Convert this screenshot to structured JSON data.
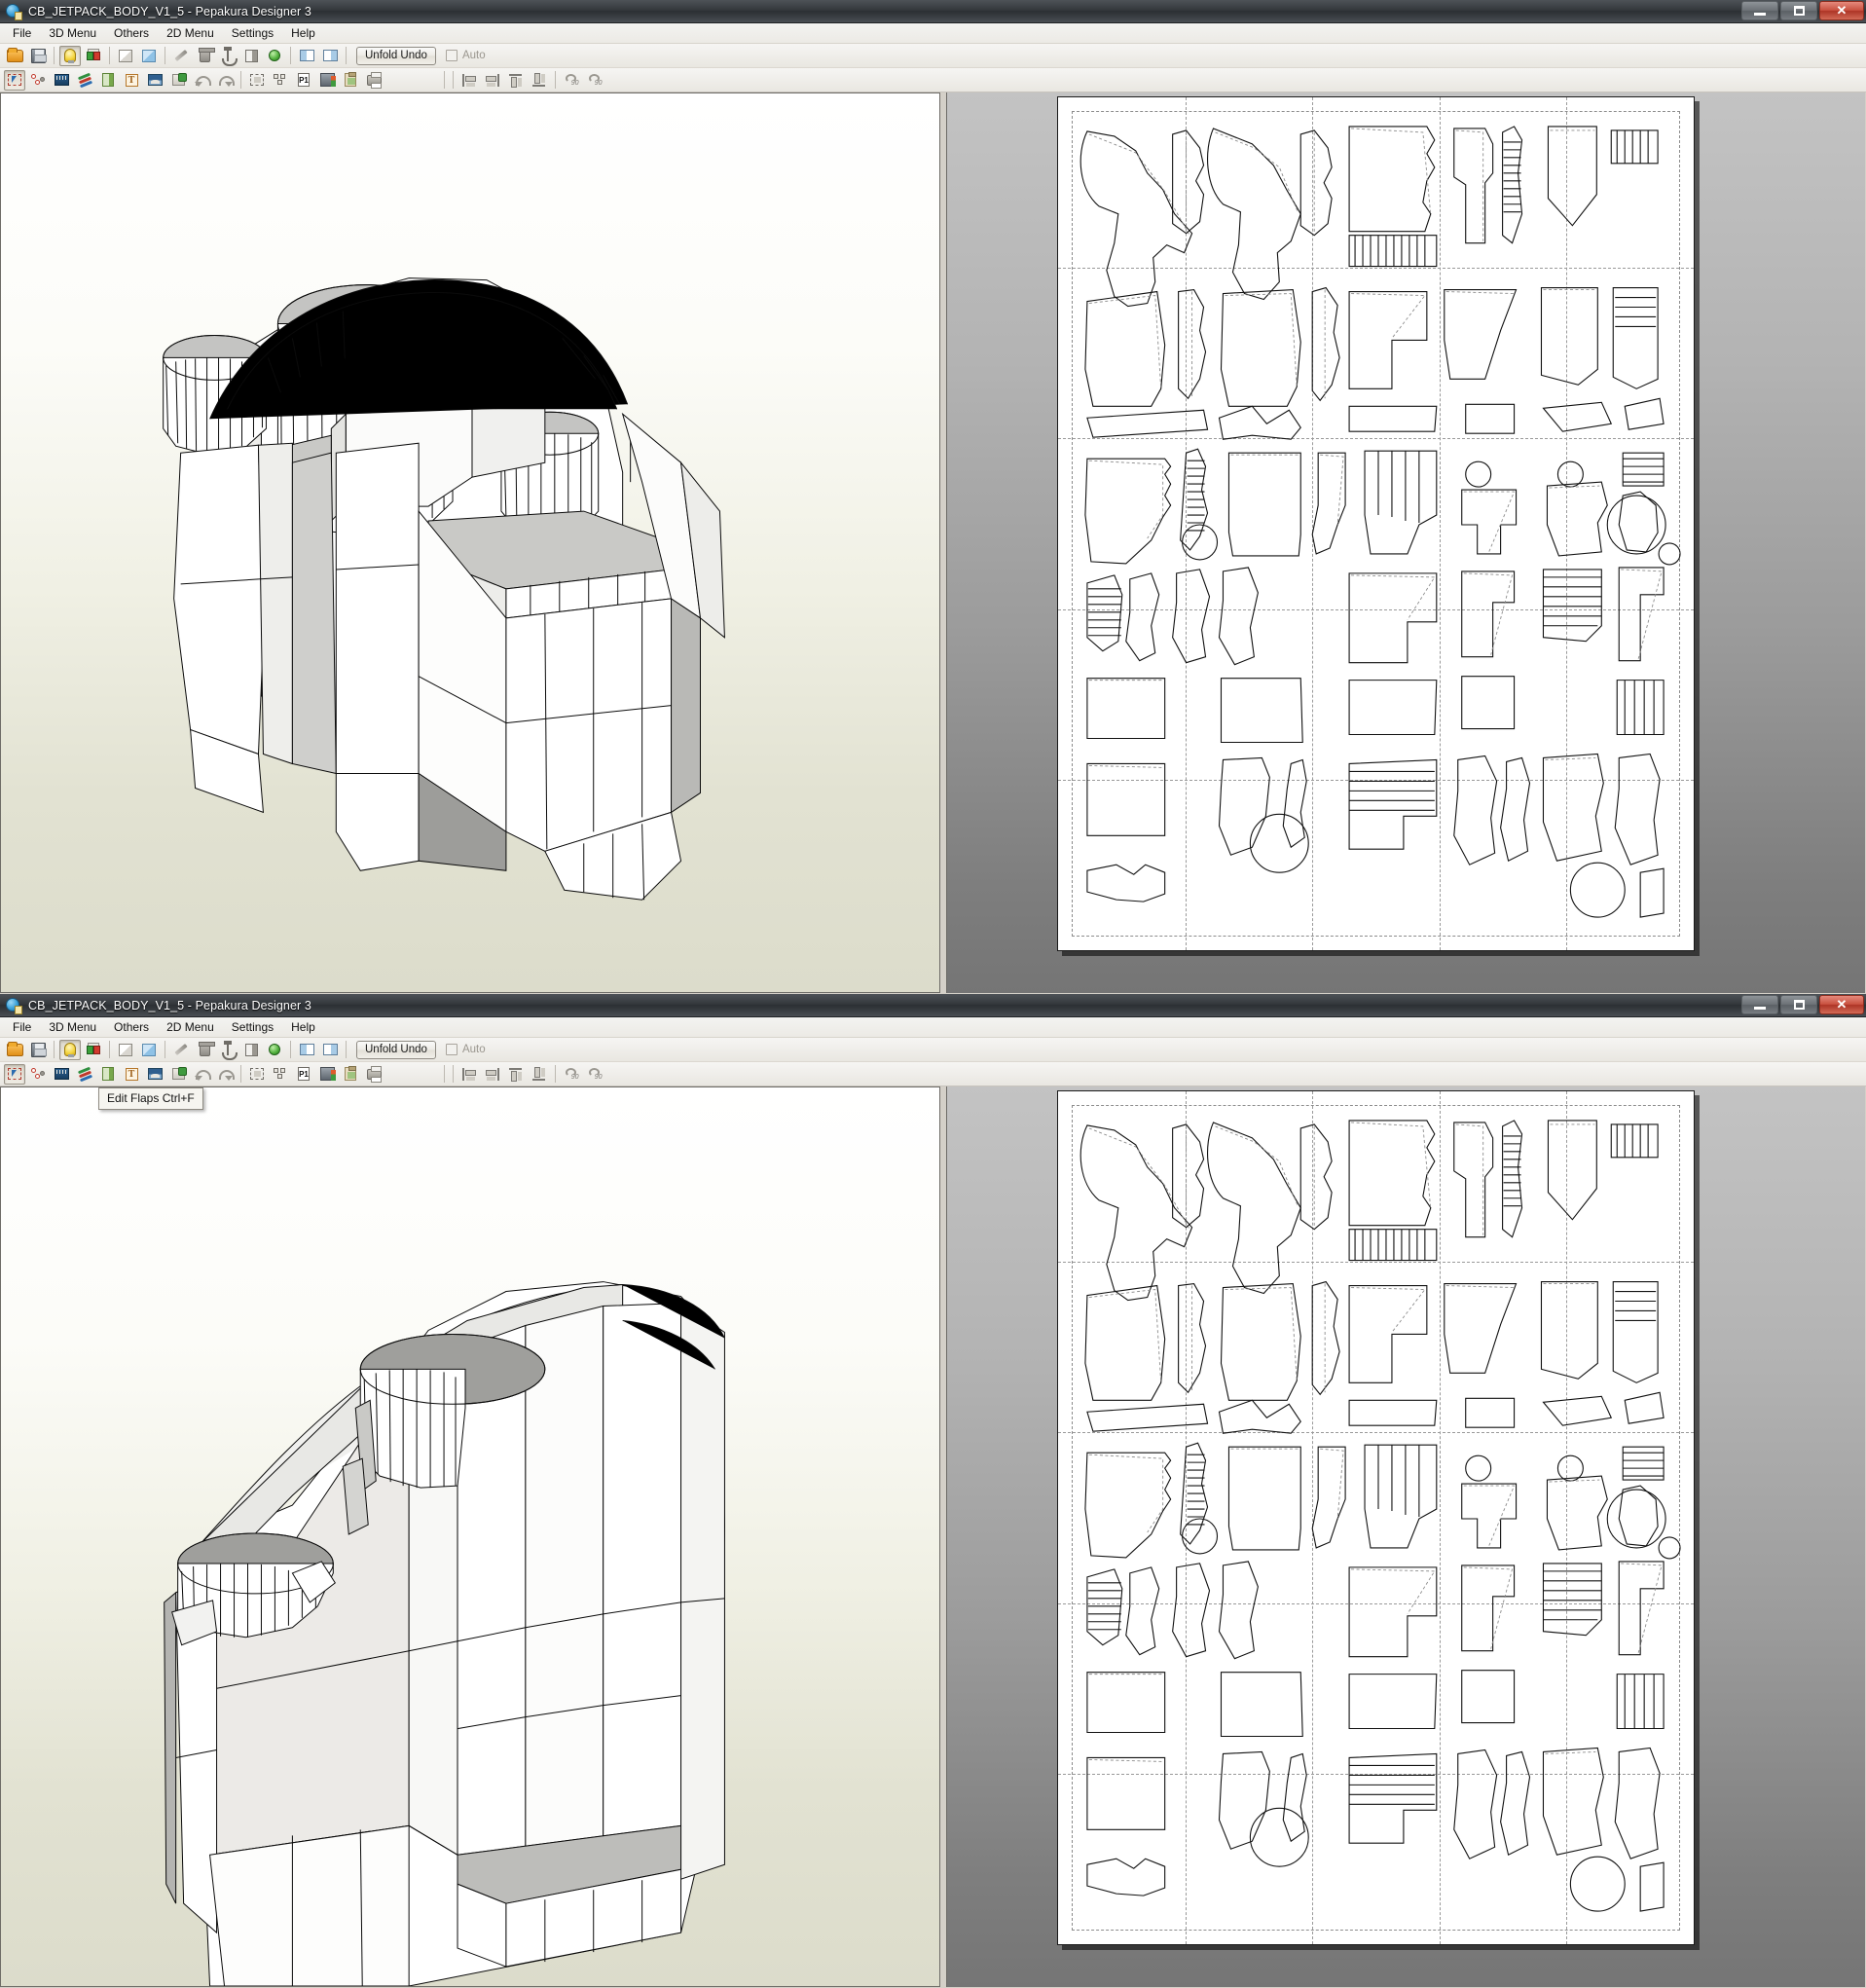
{
  "app": {
    "title": "CB_JETPACK_BODY_V1_5 - Pepakura Designer 3",
    "icon": "pepakura-globe-icon"
  },
  "window_controls": {
    "minimize": "minimize-button",
    "maximize": "restore-button",
    "close": "✕"
  },
  "menu": {
    "items": [
      {
        "label": "File"
      },
      {
        "label": "3D Menu"
      },
      {
        "label": "Others"
      },
      {
        "label": "2D Menu"
      },
      {
        "label": "Settings"
      },
      {
        "label": "Help"
      }
    ]
  },
  "toolbar_main": {
    "unfold_undo_label": "Unfold Undo",
    "auto_label": "Auto",
    "auto_checked": false,
    "buttons": [
      {
        "name": "open-file-icon"
      },
      {
        "name": "save-file-icon"
      },
      {
        "name": "light-bulb-icon",
        "pressed": true
      },
      {
        "name": "color-cube-icon"
      },
      {
        "name": "white-box-icon"
      },
      {
        "name": "blue-box-icon"
      },
      {
        "name": "pen-icon"
      },
      {
        "name": "cylinder-icon"
      },
      {
        "name": "anchor-icon"
      },
      {
        "name": "half-shade-box-icon"
      },
      {
        "name": "green-globe-icon"
      },
      {
        "name": "pane-left-icon"
      },
      {
        "name": "pane-right-icon"
      }
    ]
  },
  "toolbar_edit": {
    "buttons": [
      {
        "name": "select-tool-icon",
        "pressed": true
      },
      {
        "name": "vertex-join-icon"
      },
      {
        "name": "measure-ruler-icon"
      },
      {
        "name": "edit-flaps-icon"
      },
      {
        "name": "open-book-icon"
      },
      {
        "name": "add-text-icon"
      },
      {
        "name": "add-image-icon"
      },
      {
        "name": "paint-box-icon"
      },
      {
        "name": "undo-icon"
      },
      {
        "name": "redo-icon"
      },
      {
        "name": "marquee-select-icon"
      },
      {
        "name": "arrange-parts-icon"
      },
      {
        "name": "page-setup-icon"
      },
      {
        "name": "export-save-icon"
      },
      {
        "name": "clipboard-icon"
      },
      {
        "name": "print-icon"
      }
    ]
  },
  "toolbar_align": {
    "buttons": [
      {
        "name": "align-left-icon"
      },
      {
        "name": "align-right-icon"
      },
      {
        "name": "align-top-icon"
      },
      {
        "name": "align-bottom-icon"
      },
      {
        "name": "rotate-ccw-90-icon",
        "label": "90"
      },
      {
        "name": "rotate-cw-90-icon",
        "label": "90"
      }
    ]
  },
  "tooltip": {
    "visible": true,
    "text": "Edit Flaps Ctrl+F"
  },
  "view_3d": {
    "name": "3d-model-viewport",
    "model_name": "jetpack-body-mesh",
    "background_top": "#ffffff",
    "background_bottom": "#dcdccb"
  },
  "view_2d": {
    "name": "2d-unfold-viewport",
    "background_top": "#c3c3c3",
    "background_bottom": "#757575",
    "sheet_color": "#ffffff",
    "grid_columns": 5,
    "grid_rows": 5
  }
}
